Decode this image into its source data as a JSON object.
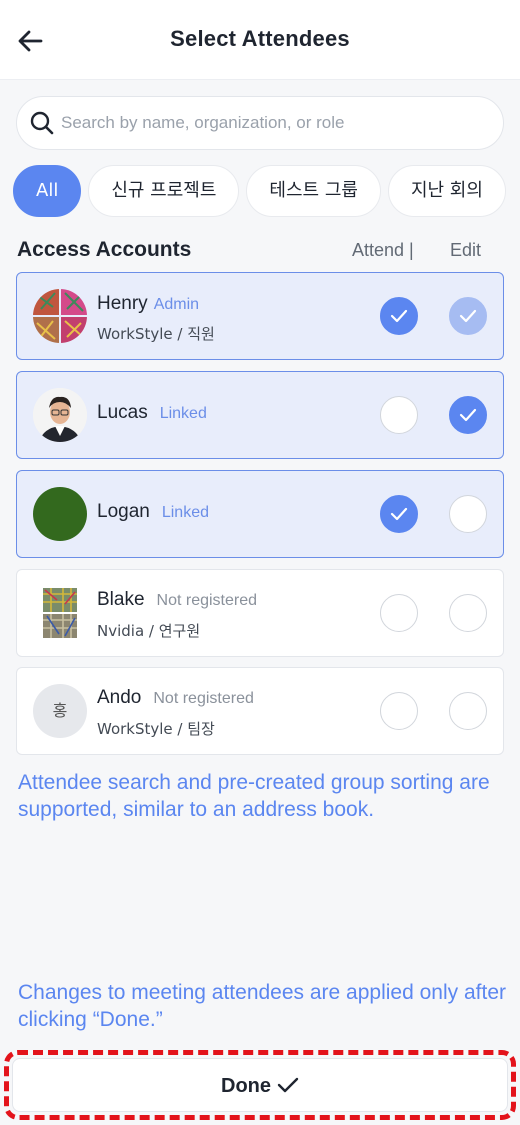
{
  "header": {
    "title": "Select Attendees",
    "back_icon": "arrow-left-icon"
  },
  "search": {
    "placeholder": "Search by name, organization, or role",
    "value": "",
    "icon": "search-icon"
  },
  "filters": [
    {
      "label": "All",
      "active": true
    },
    {
      "label": "신규 프로젝트",
      "active": false
    },
    {
      "label": "테스트 그룹",
      "active": false
    },
    {
      "label": "지난 회의",
      "active": false
    }
  ],
  "section": {
    "title": "Access Accounts",
    "attend_label": "Attend |",
    "edit_label": "Edit"
  },
  "attendees": [
    {
      "name": "Henry",
      "badge": "Admin",
      "org": "WorkStyle / 직원",
      "attend": true,
      "edit": true,
      "edit_disabled": true,
      "selected": true
    },
    {
      "name": "Lucas",
      "badge": "Linked",
      "org": "",
      "attend": false,
      "edit": true,
      "selected": true
    },
    {
      "name": "Logan",
      "badge": "Linked",
      "org": "",
      "attend": true,
      "edit": false,
      "selected": true
    },
    {
      "name": "Blake",
      "badge": "Not registered",
      "org": "Nvidia / 연구원",
      "attend": false,
      "edit": false,
      "selected": false
    },
    {
      "name": "Ando",
      "badge": "Not registered",
      "org": "WorkStyle / 팀장",
      "attend": false,
      "edit": false,
      "selected": false,
      "avatar_initial": "홍"
    }
  ],
  "notes": {
    "search_note": "Attendee search and pre-created group sorting are supported, similar to an address book.",
    "done_note": "Changes to meeting attendees are applied only after clicking “Done.”"
  },
  "done": {
    "label": "Done",
    "icon": "checkmark-icon"
  },
  "colors": {
    "accent": "#5b86f0",
    "highlight_outline": "#e3131b",
    "selected_card_bg": "#e8edfb"
  }
}
